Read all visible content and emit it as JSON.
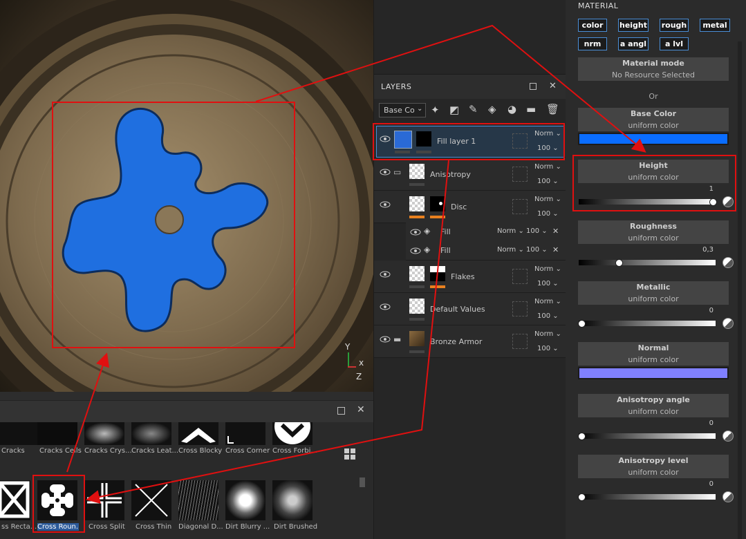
{
  "layers_panel": {
    "title": "LAYERS",
    "channel_select": "Base Co",
    "rows": [
      {
        "name": "Fill layer 1",
        "blend": "Norm",
        "opacity": "100"
      },
      {
        "name": "Anisotropy",
        "blend": "Norm",
        "opacity": "100"
      },
      {
        "name": "Disc",
        "blend": "Norm",
        "opacity": "100"
      },
      {
        "name": "Fill",
        "blend": "Norm",
        "opacity": "100"
      },
      {
        "name": "Fill",
        "blend": "Norm",
        "opacity": "100"
      },
      {
        "name": "Flakes",
        "blend": "Norm",
        "opacity": "100"
      },
      {
        "name": "Default Values",
        "blend": "Norm",
        "opacity": "100"
      },
      {
        "name": "Bronze Armor",
        "blend": "Norm",
        "opacity": "100"
      }
    ]
  },
  "material_panel": {
    "title": "MATERIAL",
    "channel_chips": [
      "color",
      "height",
      "rough",
      "metal",
      "nrm",
      "a angl",
      "a lvl"
    ],
    "material_mode": {
      "title": "Material mode",
      "value": "No Resource Selected"
    },
    "or_label": "Or",
    "params": [
      {
        "title": "Base Color",
        "sub": "uniform color",
        "kind": "color",
        "color": "#0a6dff"
      },
      {
        "title": "Height",
        "sub": "uniform color",
        "kind": "slider",
        "value": "1",
        "fraction": 1.0
      },
      {
        "title": "Roughness",
        "sub": "uniform color",
        "kind": "slider",
        "value": "0,3",
        "fraction": 0.3
      },
      {
        "title": "Metallic",
        "sub": "uniform color",
        "kind": "slider",
        "value": "0",
        "fraction": 0.0
      },
      {
        "title": "Normal",
        "sub": "uniform color",
        "kind": "color",
        "color": "#8080ff"
      },
      {
        "title": "Anisotropy angle",
        "sub": "uniform color",
        "kind": "slider",
        "value": "0",
        "fraction": 0.0
      },
      {
        "title": "Anisotropy level",
        "sub": "uniform color",
        "kind": "slider",
        "value": "0",
        "fraction": 0.0
      }
    ]
  },
  "shelf": {
    "row1": [
      "Cracks",
      "Cracks Cells",
      "Cracks Crys...",
      "Cracks Leat...",
      "Cross Blocky",
      "Cross Corner",
      "Cross Forbi..."
    ],
    "row2": [
      "ss Recta...",
      "Cross Roun...",
      "Cross Split",
      "Cross Thin",
      "Diagonal D...",
      "Dirt Blurry ...",
      "Dirt Brushed"
    ]
  },
  "viewport": {
    "axis_labels": {
      "y": "Y",
      "x": "x",
      "z": "Z"
    },
    "stamp_color": "#1f6fe0"
  },
  "colors": {
    "highlight": "#e01010",
    "accent": "#4a8fd8"
  }
}
